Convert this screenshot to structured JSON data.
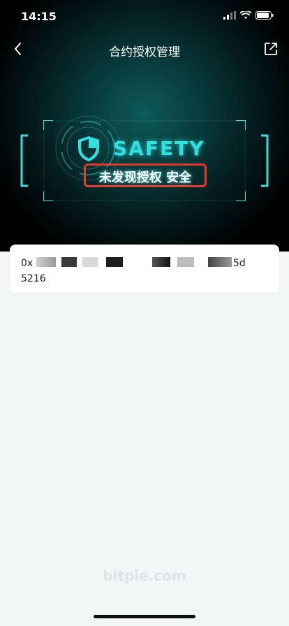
{
  "status_bar": {
    "time": "14:15"
  },
  "nav": {
    "title": "合约授权管理"
  },
  "banner": {
    "safety_label": "SAFETY",
    "status_text": "未发现授权 安全"
  },
  "address_card": {
    "address_line1": "0x",
    "address_suffix": "5d",
    "address_line2": "5216"
  },
  "watermark": "bitpie.com",
  "colors": {
    "accent_cyan": "#2ee0e0",
    "highlight_red": "#e23a2b",
    "page_background": "#f2f6f7"
  },
  "icons": [
    "back-arrow-icon",
    "share-icon",
    "shield-icon",
    "signal-icon",
    "wifi-icon",
    "battery-icon"
  ]
}
